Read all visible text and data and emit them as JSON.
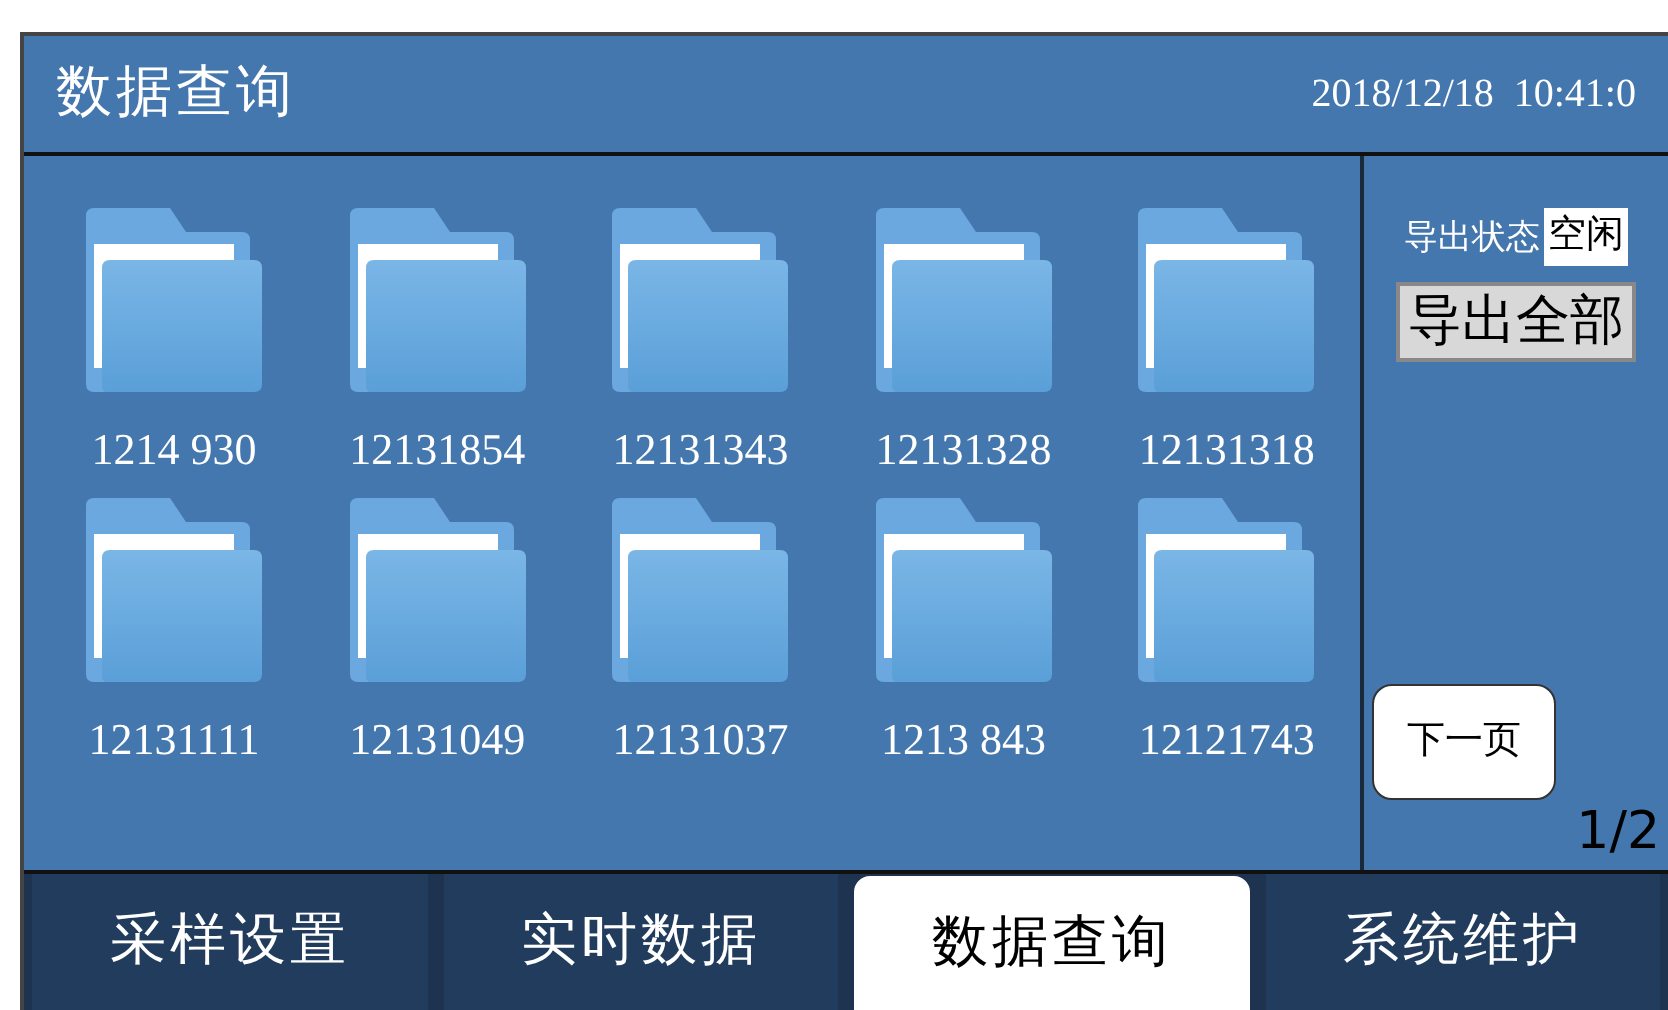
{
  "header": {
    "title": "数据查询",
    "datetime": "2018/12/18  10:41:0"
  },
  "folders": [
    {
      "name": "1214 930"
    },
    {
      "name": "12131854"
    },
    {
      "name": "12131343"
    },
    {
      "name": "12131328"
    },
    {
      "name": "12131318"
    },
    {
      "name": "12131111"
    },
    {
      "name": "12131049"
    },
    {
      "name": "12131037"
    },
    {
      "name": "1213 843"
    },
    {
      "name": "12121743"
    }
  ],
  "export": {
    "status_label": "导出状态",
    "status_value": "空闲",
    "button": "导出全部"
  },
  "pager": {
    "next": "下一页",
    "page": "1/2"
  },
  "tabs": [
    {
      "label": "采样设置",
      "selected": false
    },
    {
      "label": "实时数据",
      "selected": false
    },
    {
      "label": "数据查询",
      "selected": true
    },
    {
      "label": "系统维护",
      "selected": false
    }
  ]
}
